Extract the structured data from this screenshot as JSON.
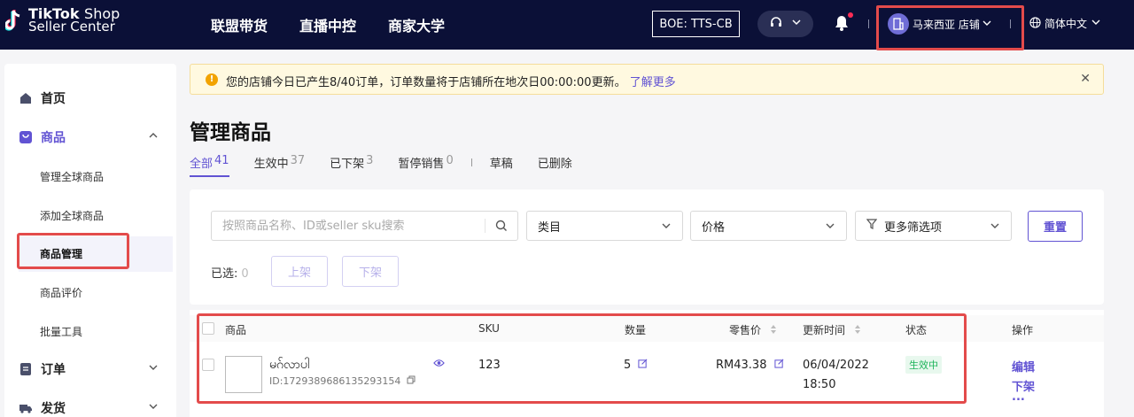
{
  "topbar": {
    "logo_brand": "TikTok",
    "logo_suffix": "Shop",
    "logo_line2": "Seller Center",
    "nav": [
      "联盟带货",
      "直播中控",
      "商家大学"
    ],
    "env_badge": "BOE: TTS-CB",
    "shop_name": "马来西亚 店铺",
    "language": "简体中文"
  },
  "sidebar": {
    "items": [
      {
        "label": "首页",
        "icon": "home-icon"
      },
      {
        "label": "商品",
        "icon": "product-bag-icon"
      },
      {
        "label": "订单",
        "icon": "order-icon"
      },
      {
        "label": "发货",
        "icon": "truck-icon"
      }
    ],
    "product_sub": [
      "管理全球商品",
      "添加全球商品",
      "商品管理",
      "商品评价",
      "批量工具"
    ],
    "active_sub": "商品管理"
  },
  "alert": {
    "text": "您的店铺今日已产生8/40订单，订单数量将于店铺所在地次日00:00:00更新。",
    "link": "了解更多"
  },
  "page": {
    "title": "管理商品",
    "tabs": [
      {
        "label": "全部",
        "count": "41",
        "active": true
      },
      {
        "label": "生效中",
        "count": "37"
      },
      {
        "label": "已下架",
        "count": "3"
      },
      {
        "label": "暂停销售",
        "count": "0"
      },
      {
        "label": "草稿",
        "count": ""
      },
      {
        "label": "已删除",
        "count": ""
      }
    ]
  },
  "filters": {
    "search_placeholder": "按照商品名称、ID或seller sku搜索",
    "category": "类目",
    "price": "价格",
    "more": "更多筛选项",
    "reset": "重置",
    "selected_label": "已选:",
    "selected_count": "0",
    "list_button": "上架",
    "delist_button": "下架"
  },
  "table": {
    "headers": {
      "product": "商品",
      "sku": "SKU",
      "quantity": "数量",
      "price": "零售价",
      "updated": "更新时间",
      "status": "状态",
      "actions": "操作"
    },
    "rows": [
      {
        "name": "မဂ်လာပါ",
        "id": "ID:1729389686135293154",
        "sku": "123",
        "quantity": "5",
        "price": "RM43.38",
        "updated_date": "06/04/2022",
        "updated_time": "18:50",
        "status": "生效中",
        "action_edit": "编辑",
        "action_delist": "下架",
        "action_more": "..."
      }
    ]
  },
  "colors": {
    "topbar_bg": "#0b1037",
    "accent": "#6153d3",
    "highlight_box": "#e34b4b",
    "status_green": "#1fb45b"
  }
}
